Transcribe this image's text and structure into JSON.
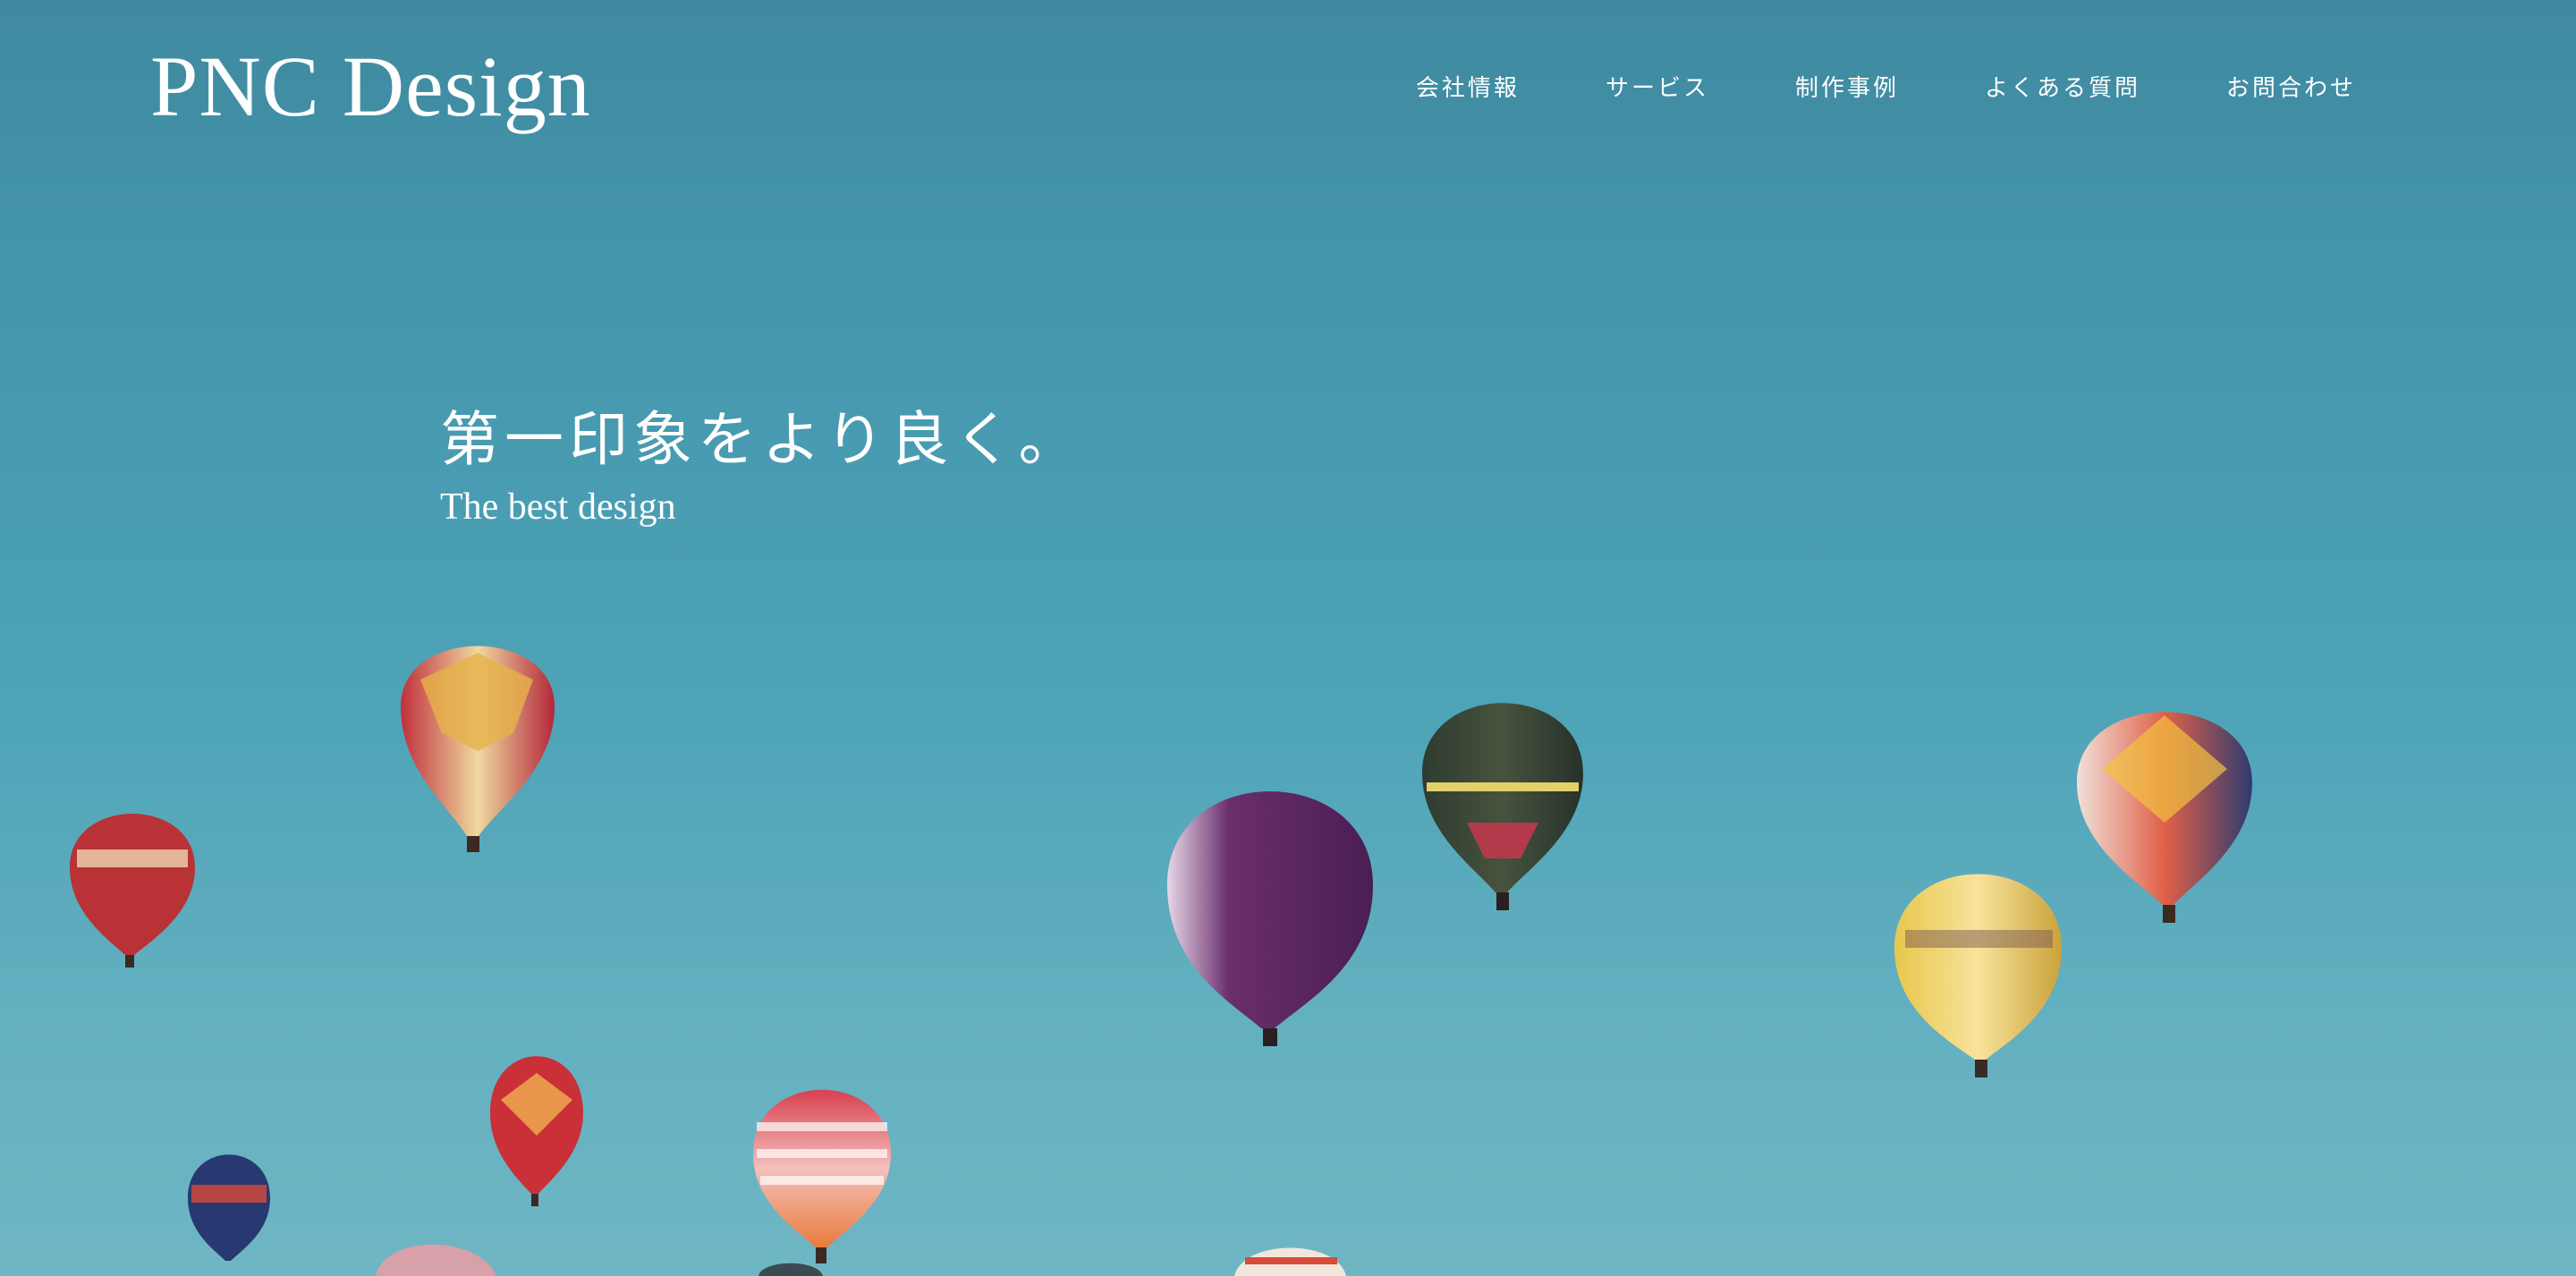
{
  "header": {
    "brand": "PNC Design",
    "nav": [
      {
        "label": "会社情報"
      },
      {
        "label": "サービス"
      },
      {
        "label": "制作事例"
      },
      {
        "label": "よくある質問"
      },
      {
        "label": "お問合わせ"
      }
    ]
  },
  "hero": {
    "catchphrase": "第一印象をより良く。",
    "subline": "The best design",
    "background": "hot-air-balloons-photo",
    "sky_colors": [
      "#3f8aa0",
      "#4ea3b7",
      "#6fb6c4"
    ]
  }
}
